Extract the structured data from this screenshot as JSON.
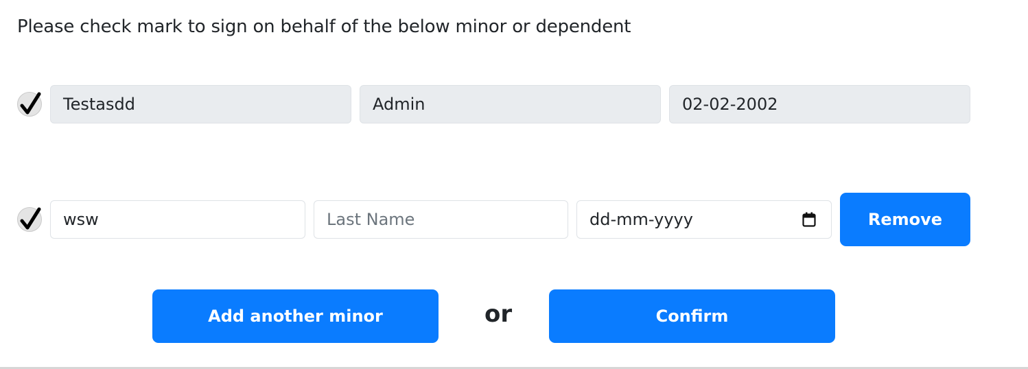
{
  "heading": "Please check mark to sign on behalf of the below minor or dependent",
  "existing_minor": {
    "checked": true,
    "first_name": "Testasdd",
    "last_name": "Admin",
    "dob": "02-02-2002"
  },
  "new_minor": {
    "checked": true,
    "first_name_value": "wsw",
    "last_name_placeholder": "Last Name",
    "dob_placeholder": "dd-mm-yyyy",
    "remove_label": "Remove"
  },
  "actions": {
    "add_label": "Add another minor",
    "or_label": "or",
    "confirm_label": "Confirm"
  },
  "colors": {
    "primary": "#0a7cff",
    "disabled_field": "#e9ecef",
    "text": "#212529"
  },
  "icons": [
    "checkmark-icon",
    "calendar-icon"
  ]
}
